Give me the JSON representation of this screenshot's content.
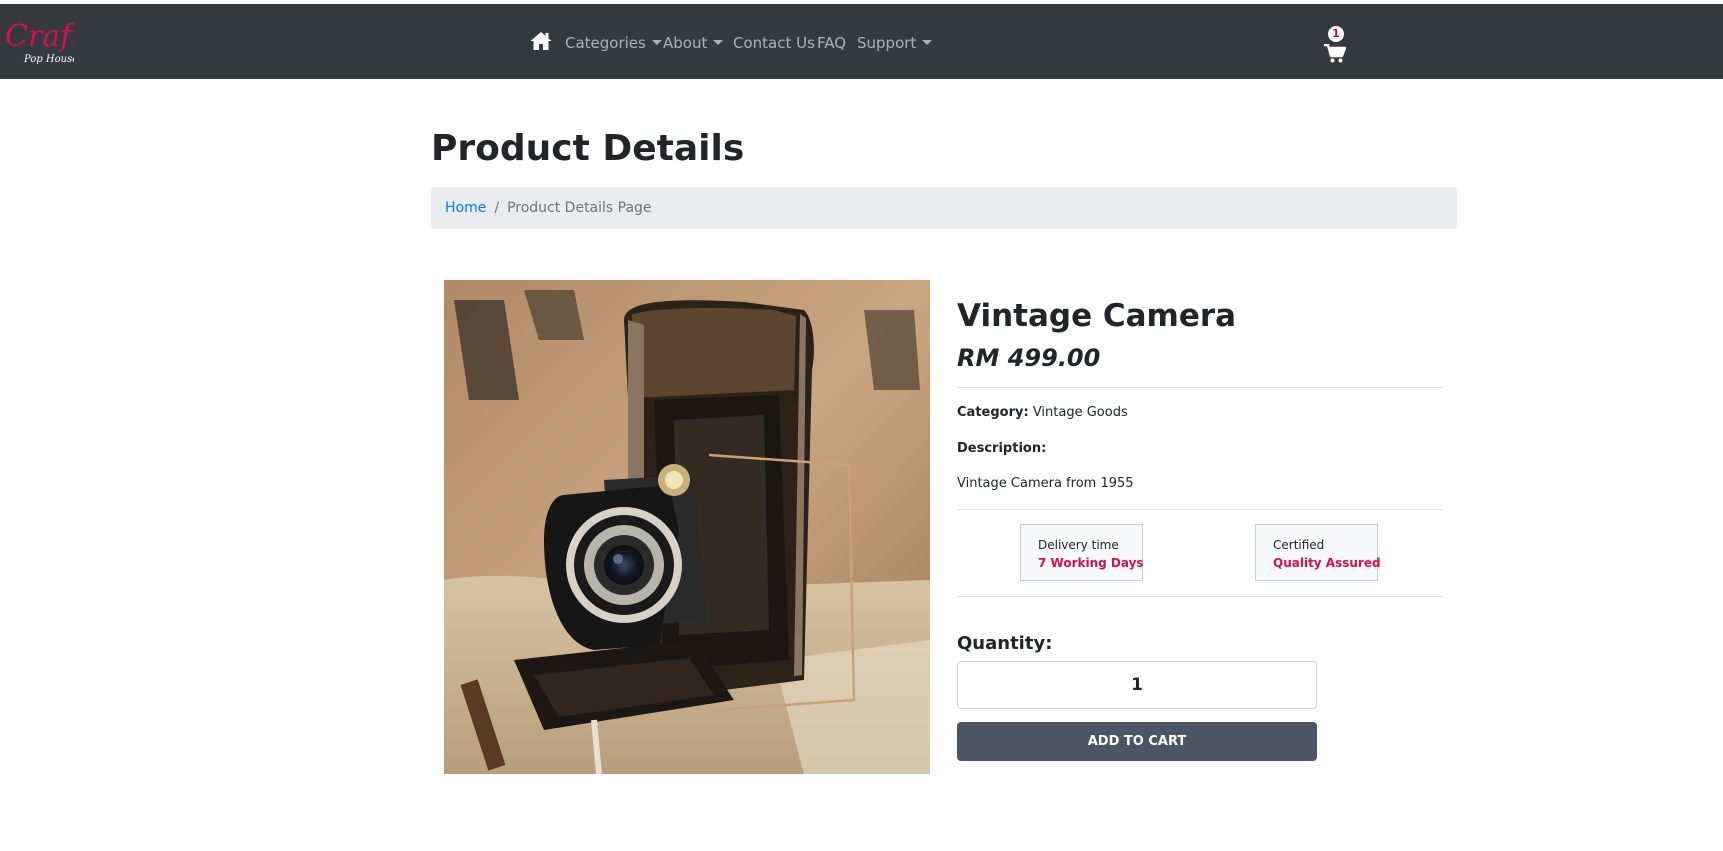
{
  "brand": {
    "logo_top": "Craft",
    "logo_bottom": "Pop House",
    "logo_color": "#d6104a"
  },
  "navbar": {
    "home_icon": "home-icon",
    "items": [
      {
        "label": "Categories",
        "dropdown": true
      },
      {
        "label": "About",
        "dropdown": true
      },
      {
        "label": "Contact Us",
        "dropdown": false
      },
      {
        "label": "FAQ",
        "dropdown": false
      },
      {
        "label": "Support",
        "dropdown": true
      }
    ],
    "cart_count": "1",
    "cart_icon": "shopping-cart-icon"
  },
  "page": {
    "title": "Product Details"
  },
  "breadcrumb": {
    "home": "Home",
    "separator": "/",
    "current": "Product Details Page"
  },
  "product": {
    "name": "Vintage Camera",
    "price": "RM 499.00",
    "category_label": "Category:",
    "category": "Vintage Goods",
    "description_label": "Description:",
    "description": "Vintage Camera from 1955"
  },
  "features": [
    {
      "title": "Delivery time",
      "value": "7 Working Days"
    },
    {
      "title": "Certified",
      "value": "Quality Assured"
    }
  ],
  "purchase": {
    "quantity_label": "Quantity:",
    "quantity_value": "1",
    "add_to_cart": "ADD TO CART"
  },
  "colors": {
    "navbar": "#343a40",
    "accent": "#d6104a",
    "link": "#007bff",
    "button": "#4b5566"
  }
}
